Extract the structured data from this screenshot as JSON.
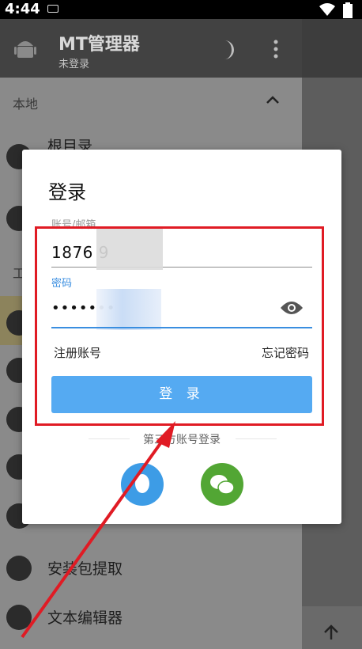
{
  "status_bar": {
    "time": "4:44"
  },
  "app": {
    "title": "MT管理器",
    "subtitle": "未登录"
  },
  "drawer": {
    "section_local": "本地",
    "section_tools": "工",
    "items": [
      {
        "label": "根目录"
      },
      {
        "label": "安装包提取"
      },
      {
        "label": "文本编辑器"
      }
    ]
  },
  "dialog": {
    "title": "登录",
    "account_label": "账号/邮箱",
    "account_value": "1876 9",
    "password_label": "密码",
    "password_value": "•••••••",
    "register_label": "注册账号",
    "forgot_label": "忘记密码",
    "login_button": "登 录",
    "third_party_label": "第三方账号登录"
  },
  "colors": {
    "accent": "#55aaf2",
    "annotation": "#e01b24",
    "qq": "#3d9ce6",
    "wechat": "#52a634"
  }
}
